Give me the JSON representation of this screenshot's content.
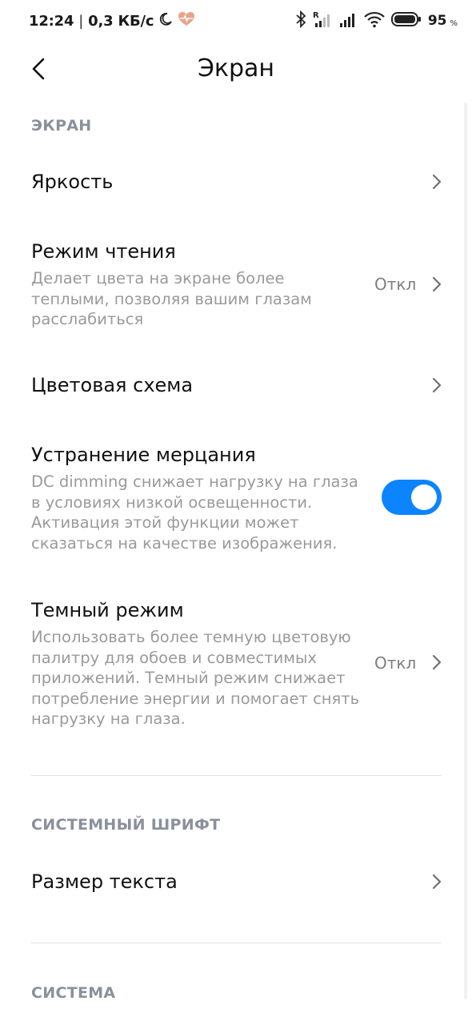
{
  "status_bar": {
    "time": "12:24",
    "separator": "|",
    "speed": "0,3 КБ/с",
    "icons_left": [
      "moon-icon",
      "heart-rate-icon"
    ],
    "icons_right": [
      "bluetooth-icon",
      "signal-roaming-icon",
      "signal-icon",
      "wifi-icon",
      "battery-icon"
    ],
    "battery_level": "95",
    "battery_percent_sign": "%"
  },
  "header": {
    "back_icon": "chevron-left-icon",
    "title": "Экран"
  },
  "sections": {
    "screen": {
      "header": "ЭКРАН",
      "brightness": {
        "title": "Яркость"
      },
      "reading_mode": {
        "title": "Режим чтения",
        "subtitle": "Делает цвета на экране более теплыми, позволяя вашим глазам расслабиться",
        "value": "Откл"
      },
      "color_scheme": {
        "title": "Цветовая схема"
      },
      "flicker": {
        "title": "Устранение мерцания",
        "subtitle": "DC dimming снижает нагрузку на глаза в условиях низкой освещенности. Активация этой функции может сказаться на качестве изображения.",
        "enabled": true
      },
      "dark_mode": {
        "title": "Темный режим",
        "subtitle": "Использовать более темную цветовую палитру для обоев и совместимых приложений. Темный режим снижает потребление энергии и помогает снять нагрузку на глаза.",
        "value": "Откл"
      }
    },
    "system_font": {
      "header": "СИСТЕМНЫЙ ШРИФТ",
      "text_size": {
        "title": "Размер текста"
      }
    },
    "system": {
      "header": "СИСТЕМА"
    }
  },
  "colors": {
    "accent": "#0d84ff",
    "section_header": "#8a909c",
    "subtitle": "#9a9a9a",
    "value": "#7e7e7e"
  }
}
